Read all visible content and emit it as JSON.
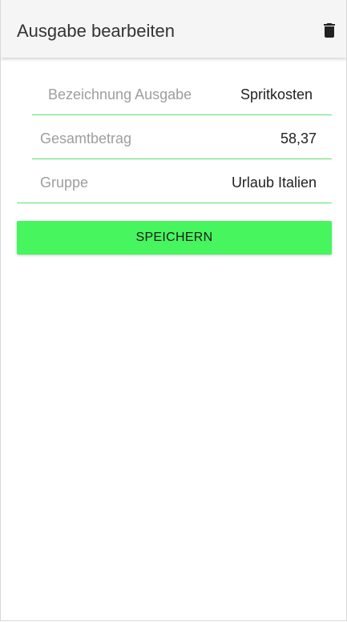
{
  "header": {
    "title": "Ausgabe bearbeiten",
    "delete_icon": "trash-icon"
  },
  "form": {
    "name": {
      "label": "Bezeichnung Ausgabe",
      "value": "Spritkosten"
    },
    "total": {
      "label": "Gesamtbetrag",
      "value": "58,37"
    },
    "group": {
      "label": "Gruppe",
      "value": "Urlaub Italien"
    }
  },
  "actions": {
    "save_label": "SPEICHERN"
  },
  "colors": {
    "accent": "#47f55f",
    "underline": "#5be06f",
    "app_bar": "#f5f5f5"
  }
}
